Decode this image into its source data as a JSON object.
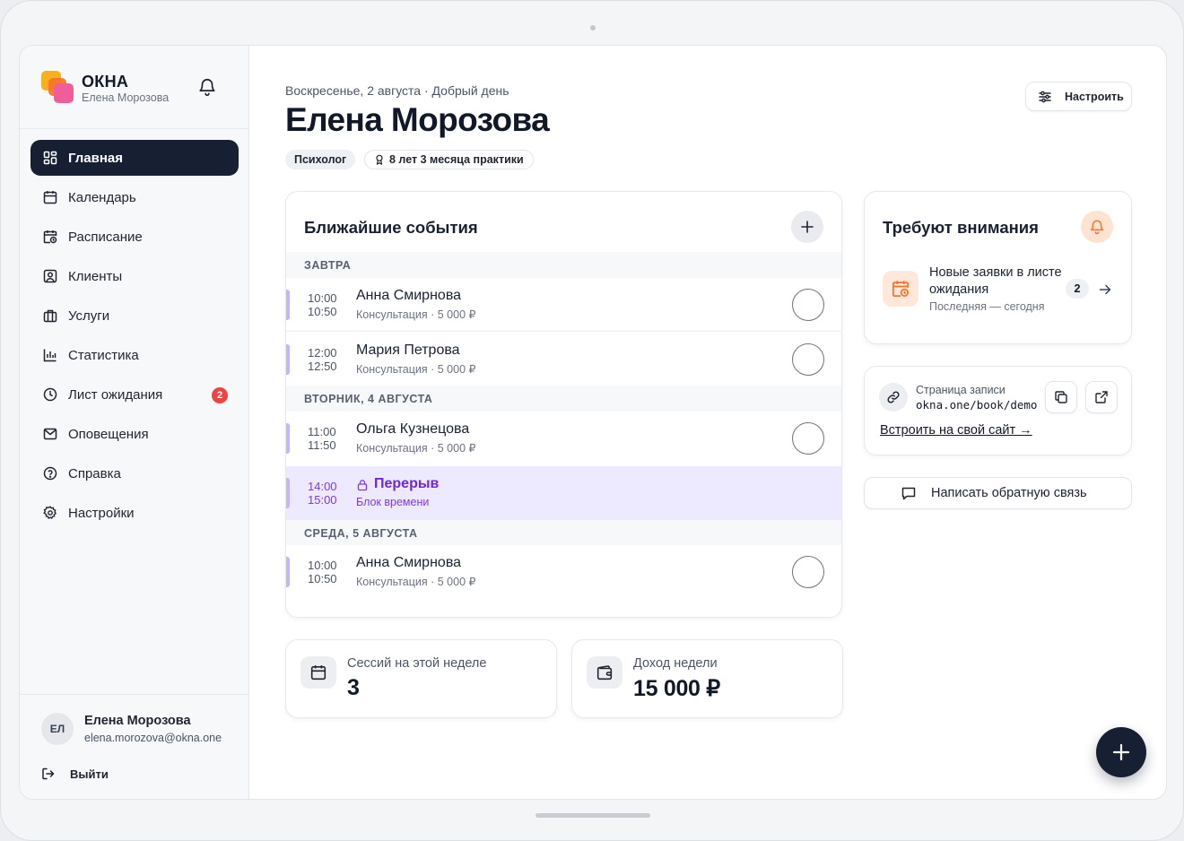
{
  "app": {
    "brand_name": "ОКНА",
    "brand_user": "Елена Морозова",
    "brand_colors": [
      "#f7b21b",
      "#f5732c",
      "#ef5d9b"
    ],
    "notifications_icon": "bell-icon"
  },
  "sidebar": {
    "items": [
      {
        "label": "Главная",
        "icon": "dashboard-icon",
        "active": true
      },
      {
        "label": "Календарь",
        "icon": "calendar-icon"
      },
      {
        "label": "Расписание",
        "icon": "schedule-icon"
      },
      {
        "label": "Клиенты",
        "icon": "clients-icon"
      },
      {
        "label": "Услуги",
        "icon": "briefcase-icon"
      },
      {
        "label": "Статистика",
        "icon": "chart-icon"
      },
      {
        "label": "Лист ожидания",
        "icon": "clock-icon",
        "badge": "2"
      },
      {
        "label": "Оповещения",
        "icon": "mail-icon"
      },
      {
        "label": "Справка",
        "icon": "help-icon"
      },
      {
        "label": "Настройки",
        "icon": "gear-icon"
      }
    ],
    "user": {
      "initials": "ЕЛ",
      "name": "Елена Морозова",
      "email": "elena.morozova@okna.one"
    },
    "logout_label": "Выйти"
  },
  "header": {
    "subtitle": "Воскресенье, 2 августа · Добрый день",
    "title": "Елена Морозова",
    "chip_role": "Психолог",
    "chip_experience": "8 лет 3 месяца практики",
    "configure_label": "Настроить"
  },
  "events": {
    "title": "Ближайшие события",
    "days": [
      {
        "label": "ЗАВТРА"
      },
      {
        "label": "ВТОРНИК, 4 АВГУСТА"
      },
      {
        "label": "СРЕДА, 5 АВГУСТА"
      }
    ],
    "items": [
      {
        "start": "10:00",
        "end": "10:50",
        "name": "Анна Смирнова",
        "sub": "Консультация · 5 000 ₽"
      },
      {
        "start": "12:00",
        "end": "12:50",
        "name": "Мария Петрова",
        "sub": "Консультация · 5 000 ₽"
      },
      {
        "start": "11:00",
        "end": "11:50",
        "name": "Ольга Кузнецова",
        "sub": "Консультация · 5 000 ₽"
      },
      {
        "start": "14:00",
        "end": "15:00",
        "name": "Перерыв",
        "sub": "Блок времени",
        "type": "break"
      },
      {
        "start": "10:00",
        "end": "10:50",
        "name": "Анна Смирнова",
        "sub": "Консультация · 5 000 ₽"
      }
    ],
    "accent_color": "#c4b5fd",
    "break_bg": "#ede9fe"
  },
  "stats": {
    "sessions_label": "Сессий на этой неделе",
    "sessions_value": "3",
    "income_label": "Доход недели",
    "income_value": "15 000 ₽"
  },
  "attention": {
    "title": "Требуют внимания",
    "item_title": "Новые заявки в листе ожидания",
    "item_sub": "Последняя — сегодня",
    "item_count": "2",
    "accent_color": "#f5732c"
  },
  "booking": {
    "label": "Страница записи",
    "url": "okna.one/book/demo",
    "embed_label": "Встроить на свой сайт →"
  },
  "feedback_label": "Написать обратную связь"
}
